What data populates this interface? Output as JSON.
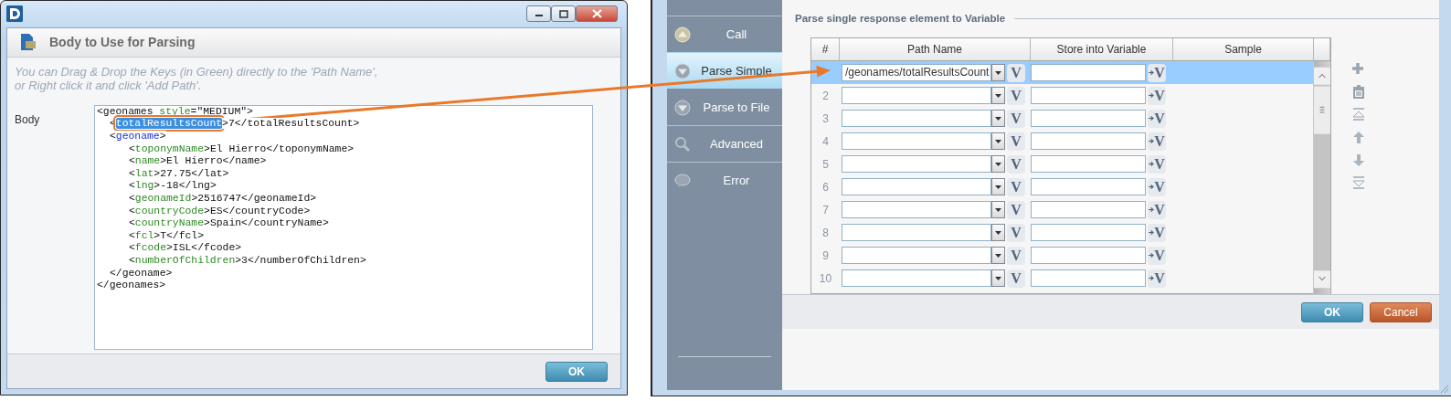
{
  "left_window": {
    "header": {
      "title": "Body to Use for Parsing"
    },
    "hint": [
      "You can Drag & Drop the Keys (in Green) directly to the 'Path Name',",
      "or Right click it and click 'Add Path'."
    ],
    "body_label": "Body",
    "body_xml": [
      {
        "parts": [
          {
            "text": "<geonames "
          },
          {
            "text": "style",
            "kind": "attr"
          },
          {
            "text": "=\"MEDIUM\">"
          }
        ],
        "closing": "</geonames>",
        "children": [
          {
            "parts": [
              {
                "text": "<"
              },
              {
                "text": "totalResultsCount",
                "kind": "key",
                "selected": true
              },
              {
                "text": ">7</totalResultsCount>"
              }
            ]
          },
          {
            "parts": [
              {
                "text": "<"
              },
              {
                "text": "geoname",
                "kind": "group"
              },
              {
                "text": ">"
              }
            ],
            "closing": "</geoname>",
            "children": [
              {
                "parts": [
                  {
                    "text": "<"
                  },
                  {
                    "text": "toponymName",
                    "kind": "key",
                    "selected": false
                  },
                  {
                    "text": ">El Hierro</toponymName>"
                  }
                ]
              },
              {
                "parts": [
                  {
                    "text": "<"
                  },
                  {
                    "text": "name",
                    "kind": "key",
                    "selected": false
                  },
                  {
                    "text": ">El Hierro</name>"
                  }
                ]
              },
              {
                "parts": [
                  {
                    "text": "<"
                  },
                  {
                    "text": "lat",
                    "kind": "key",
                    "selected": false
                  },
                  {
                    "text": ">27.75</lat>"
                  }
                ]
              },
              {
                "parts": [
                  {
                    "text": "<"
                  },
                  {
                    "text": "lng",
                    "kind": "key",
                    "selected": false
                  },
                  {
                    "text": ">-18</lng>"
                  }
                ]
              },
              {
                "parts": [
                  {
                    "text": "<"
                  },
                  {
                    "text": "geonameId",
                    "kind": "key",
                    "selected": false
                  },
                  {
                    "text": ">2516747</geonameId>"
                  }
                ]
              },
              {
                "parts": [
                  {
                    "text": "<"
                  },
                  {
                    "text": "countryCode",
                    "kind": "key",
                    "selected": false
                  },
                  {
                    "text": ">ES</countryCode>"
                  }
                ]
              },
              {
                "parts": [
                  {
                    "text": "<"
                  },
                  {
                    "text": "countryName",
                    "kind": "key",
                    "selected": false
                  },
                  {
                    "text": ">Spain</countryName>"
                  }
                ]
              },
              {
                "parts": [
                  {
                    "text": "<"
                  },
                  {
                    "text": "fcl",
                    "kind": "key",
                    "selected": false
                  },
                  {
                    "text": ">T</fcl>"
                  }
                ]
              },
              {
                "parts": [
                  {
                    "text": "<"
                  },
                  {
                    "text": "fcode",
                    "kind": "key",
                    "selected": false
                  },
                  {
                    "text": ">ISL</fcode>"
                  }
                ]
              },
              {
                "parts": [
                  {
                    "text": "<"
                  },
                  {
                    "text": "numberOfChildren",
                    "kind": "key",
                    "selected": false
                  },
                  {
                    "text": ">3</numberOfChildren>"
                  }
                ]
              }
            ]
          }
        ]
      }
    ],
    "ok_button": "OK"
  },
  "right_window": {
    "sidebar": [
      {
        "label": "Call",
        "kind": "up",
        "selected": false
      },
      {
        "label": "Parse Simple",
        "kind": "down",
        "selected": true
      },
      {
        "label": "Parse to File",
        "kind": "down",
        "selected": false
      },
      {
        "label": "Advanced",
        "kind": "search",
        "selected": false
      },
      {
        "label": "Error",
        "kind": "bubble",
        "selected": false
      }
    ],
    "section_title": "Parse single response element to Variable",
    "table": {
      "columns": [
        "#",
        "Path Name",
        "Store into Variable",
        "Sample"
      ],
      "rows": [
        {
          "path": "/geonames/totalResultsCount",
          "variable_button": "V",
          "assign_button": "V",
          "selected": true
        },
        {
          "number": "2",
          "variable_button": "V",
          "assign_button": "V",
          "selected": false
        },
        {
          "number": "3",
          "variable_button": "V",
          "assign_button": "V",
          "selected": false
        },
        {
          "number": "4",
          "variable_button": "V",
          "assign_button": "V",
          "selected": false
        },
        {
          "number": "5",
          "variable_button": "V",
          "assign_button": "V",
          "selected": false
        },
        {
          "number": "6",
          "variable_button": "V",
          "assign_button": "V",
          "selected": false
        },
        {
          "number": "7",
          "variable_button": "V",
          "assign_button": "V",
          "selected": false
        },
        {
          "number": "8",
          "variable_button": "V",
          "assign_button": "V",
          "selected": false
        },
        {
          "number": "9",
          "variable_button": "V",
          "assign_button": "V",
          "selected": false
        },
        {
          "number": "10",
          "variable_button": "V",
          "assign_button": "V",
          "selected": false
        }
      ]
    },
    "buttons": [
      {
        "label": "OK",
        "kind": "primary"
      },
      {
        "label": "Cancel",
        "kind": "cancel"
      }
    ]
  }
}
